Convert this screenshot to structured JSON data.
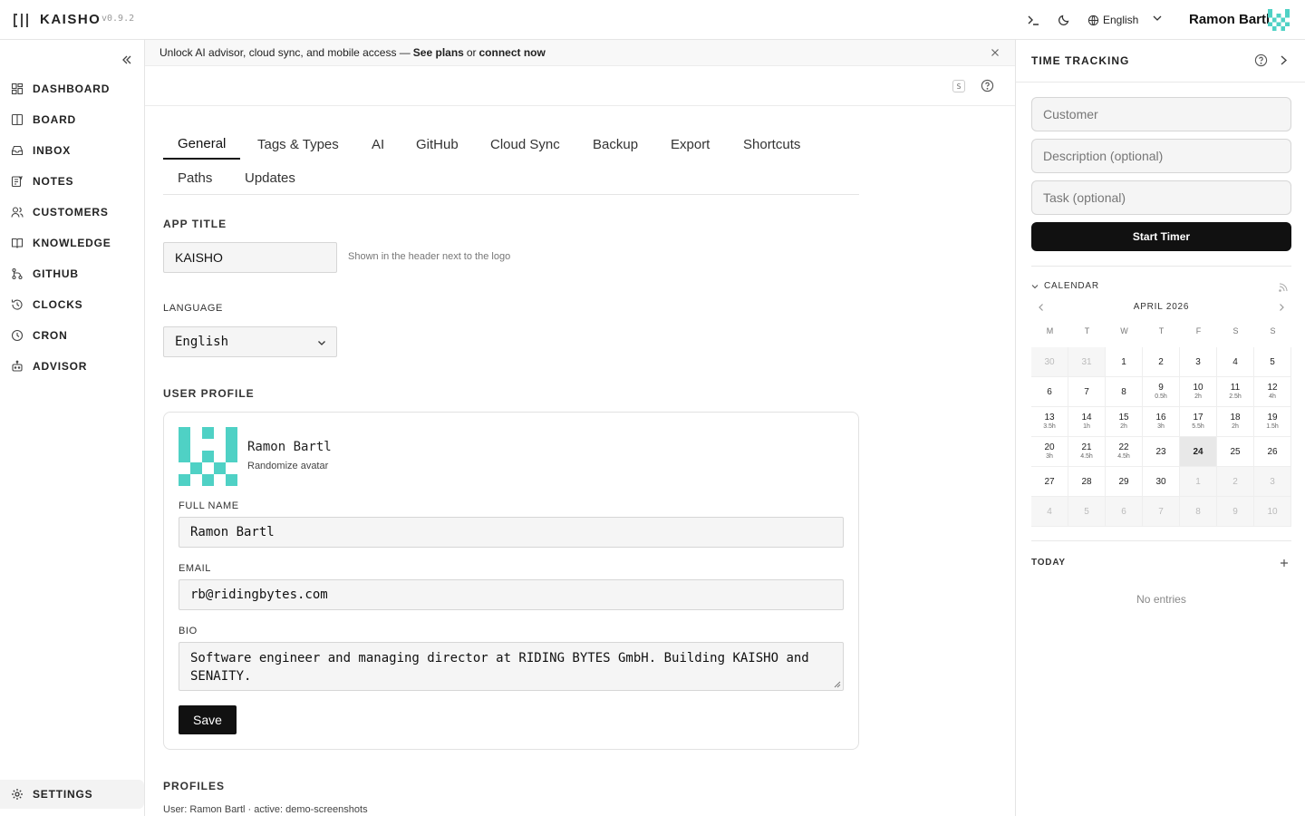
{
  "header": {
    "app_name": "KAISHO",
    "version": "v0.9.2",
    "language": "English",
    "user_name": "Ramon Bartl"
  },
  "sidebar": {
    "items": [
      {
        "label": "DASHBOARD",
        "icon": "dashboard-icon"
      },
      {
        "label": "BOARD",
        "icon": "board-icon"
      },
      {
        "label": "INBOX",
        "icon": "inbox-icon"
      },
      {
        "label": "NOTES",
        "icon": "notes-icon"
      },
      {
        "label": "CUSTOMERS",
        "icon": "customers-icon"
      },
      {
        "label": "KNOWLEDGE",
        "icon": "book-icon"
      },
      {
        "label": "GITHUB",
        "icon": "git-branch-icon"
      },
      {
        "label": "CLOCKS",
        "icon": "history-icon"
      },
      {
        "label": "CRON",
        "icon": "clock-icon"
      },
      {
        "label": "ADVISOR",
        "icon": "bot-icon"
      }
    ],
    "settings_label": "SETTINGS"
  },
  "banner": {
    "text": "Unlock AI advisor, cloud sync, and mobile access —",
    "link1": "See plans",
    "or": "or",
    "link2": "connect now"
  },
  "subbar": {
    "shortcut_badge": "S"
  },
  "tabs": {
    "row1": [
      "General",
      "Tags & Types",
      "AI",
      "GitHub",
      "Cloud Sync",
      "Backup",
      "Export",
      "Shortcuts"
    ],
    "row2": [
      "Paths",
      "Updates"
    ],
    "active": "General"
  },
  "settings": {
    "app_title_label": "APP TITLE",
    "app_title_value": "KAISHO",
    "app_title_hint": "Shown in the header next to the logo",
    "language_label": "LANGUAGE",
    "language_value": "English",
    "user_profile_label": "USER PROFILE",
    "profile": {
      "name": "Ramon Bartl",
      "randomize": "Randomize avatar",
      "full_name_label": "FULL NAME",
      "full_name": "Ramon Bartl",
      "email_label": "EMAIL",
      "email": "rb@ridingbytes.com",
      "bio_label": "BIO",
      "bio": "Software engineer and managing director at RIDING BYTES GmbH. Building KAISHO and SENAITY.",
      "save_label": "Save"
    },
    "profiles_label": "PROFILES",
    "profiles_info": "User: Ramon Bartl · active: demo-screenshots"
  },
  "time_tracking": {
    "title": "TIME TRACKING",
    "customer_placeholder": "Customer",
    "description_placeholder": "Description (optional)",
    "task_placeholder": "Task (optional)",
    "start_label": "Start Timer",
    "calendar_label": "CALENDAR",
    "month": "APRIL 2026",
    "weekdays": [
      "M",
      "T",
      "W",
      "T",
      "F",
      "S",
      "S"
    ],
    "weeks": [
      [
        {
          "d": "30",
          "h": "",
          "other": true
        },
        {
          "d": "31",
          "h": "",
          "other": true
        },
        {
          "d": "1",
          "h": ""
        },
        {
          "d": "2",
          "h": ""
        },
        {
          "d": "3",
          "h": ""
        },
        {
          "d": "4",
          "h": ""
        },
        {
          "d": "5",
          "h": ""
        }
      ],
      [
        {
          "d": "6",
          "h": ""
        },
        {
          "d": "7",
          "h": ""
        },
        {
          "d": "8",
          "h": ""
        },
        {
          "d": "9",
          "h": "0.5h"
        },
        {
          "d": "10",
          "h": "2h"
        },
        {
          "d": "11",
          "h": "2.5h"
        },
        {
          "d": "12",
          "h": "4h"
        }
      ],
      [
        {
          "d": "13",
          "h": "3.5h"
        },
        {
          "d": "14",
          "h": "1h"
        },
        {
          "d": "15",
          "h": "2h"
        },
        {
          "d": "16",
          "h": "3h"
        },
        {
          "d": "17",
          "h": "5.5h"
        },
        {
          "d": "18",
          "h": "2h"
        },
        {
          "d": "19",
          "h": "1.5h"
        }
      ],
      [
        {
          "d": "20",
          "h": "3h"
        },
        {
          "d": "21",
          "h": "4.5h"
        },
        {
          "d": "22",
          "h": "4.5h"
        },
        {
          "d": "23",
          "h": ""
        },
        {
          "d": "24",
          "h": "",
          "today": true
        },
        {
          "d": "25",
          "h": ""
        },
        {
          "d": "26",
          "h": ""
        }
      ],
      [
        {
          "d": "27",
          "h": ""
        },
        {
          "d": "28",
          "h": ""
        },
        {
          "d": "29",
          "h": ""
        },
        {
          "d": "30",
          "h": ""
        },
        {
          "d": "1",
          "h": "",
          "other": true
        },
        {
          "d": "2",
          "h": "",
          "other": true
        },
        {
          "d": "3",
          "h": "",
          "other": true
        }
      ],
      [
        {
          "d": "4",
          "h": "",
          "other": true
        },
        {
          "d": "5",
          "h": "",
          "other": true
        },
        {
          "d": "6",
          "h": "",
          "other": true
        },
        {
          "d": "7",
          "h": "",
          "other": true
        },
        {
          "d": "8",
          "h": "",
          "other": true
        },
        {
          "d": "9",
          "h": "",
          "other": true
        },
        {
          "d": "10",
          "h": "",
          "other": true
        }
      ]
    ],
    "today_label": "TODAY",
    "no_entries": "No entries"
  },
  "colors": {
    "accent": "#111111",
    "avatar": "#4fd1c5"
  }
}
